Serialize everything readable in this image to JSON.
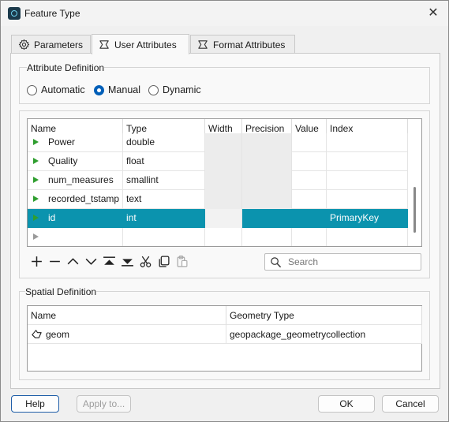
{
  "window": {
    "title": "Feature Type"
  },
  "tabs": [
    {
      "label": "Parameters",
      "icon": "gear-icon"
    },
    {
      "label": "User Attributes",
      "icon": "attribute-icon"
    },
    {
      "label": "Format Attributes",
      "icon": "attribute-icon"
    }
  ],
  "attribute_definition": {
    "title": "Attribute Definition",
    "options": [
      "Automatic",
      "Manual",
      "Dynamic"
    ],
    "selected": "Manual"
  },
  "attribute_table": {
    "columns": [
      "Name",
      "Type",
      "Width",
      "Precision",
      "Value",
      "Index"
    ],
    "rows": [
      {
        "name": "Power",
        "type": "double",
        "width": "",
        "precision": "",
        "value": "",
        "index": ""
      },
      {
        "name": "Quality",
        "type": "float",
        "width": "",
        "precision": "",
        "value": "",
        "index": ""
      },
      {
        "name": "num_measures",
        "type": "smallint",
        "width": "",
        "precision": "",
        "value": "",
        "index": ""
      },
      {
        "name": "recorded_tstamp",
        "type": "text",
        "width": "",
        "precision": "",
        "value": "",
        "index": ""
      },
      {
        "name": "id",
        "type": "int",
        "width": "",
        "precision": "",
        "value": "",
        "index": "PrimaryKey"
      }
    ],
    "selected_row": "id"
  },
  "table_tools": [
    "add-icon",
    "remove-icon",
    "move-up-icon",
    "move-down-icon",
    "move-top-icon",
    "move-bottom-icon",
    "cut-icon",
    "copy-icon",
    "paste-icon"
  ],
  "search": {
    "placeholder": "Search"
  },
  "spatial_definition": {
    "title": "Spatial Definition",
    "columns": [
      "Name",
      "Geometry Type"
    ],
    "rows": [
      {
        "name": "geom",
        "geometry_type": "geopackage_geometrycollection",
        "icon": "geometry-icon"
      }
    ]
  },
  "buttons": {
    "help": "Help",
    "apply": "Apply to...",
    "ok": "OK",
    "cancel": "Cancel"
  },
  "colors": {
    "selection": "#0b93ae",
    "accent": "#005fb8",
    "arrow": "#2f9e2f"
  }
}
